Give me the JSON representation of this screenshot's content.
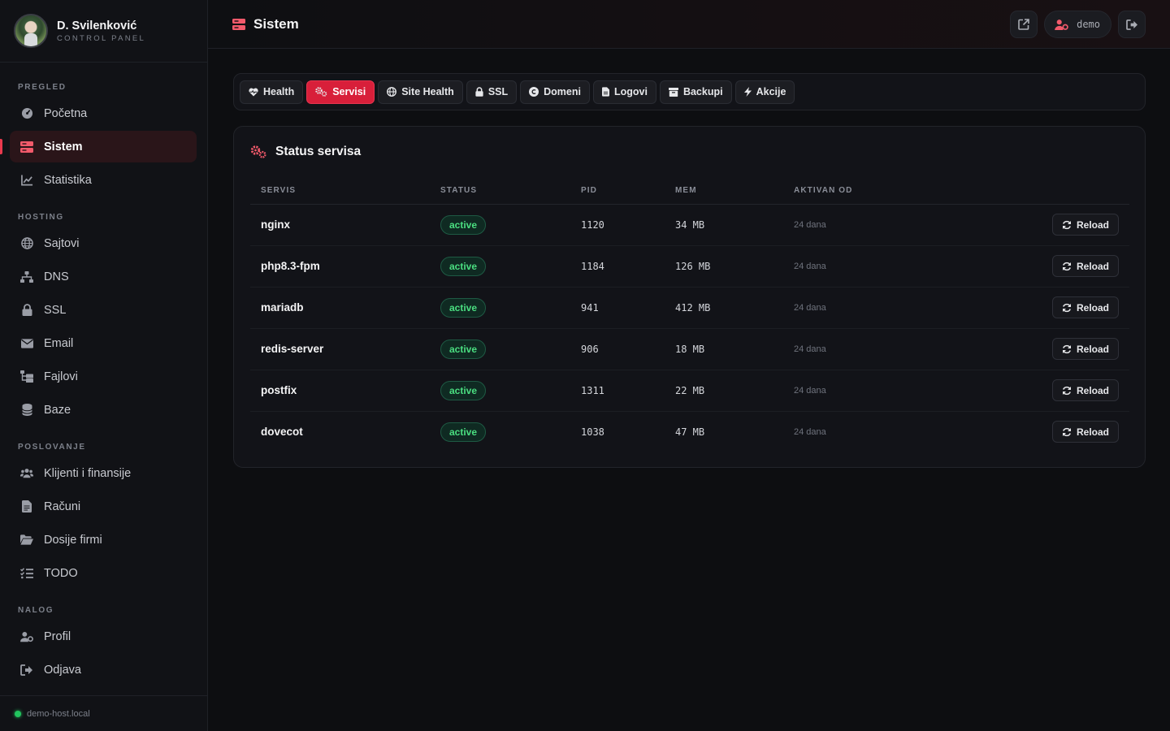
{
  "brand": {
    "name": "D. Svilenković",
    "subtitle": "CONTROL PANEL"
  },
  "sidebar": {
    "sections": [
      {
        "label": "PREGLED",
        "items": [
          {
            "label": "Početna",
            "icon": "gauge-icon"
          },
          {
            "label": "Sistem",
            "icon": "server-icon",
            "active": true
          },
          {
            "label": "Statistika",
            "icon": "chart-line-icon"
          }
        ]
      },
      {
        "label": "HOSTING",
        "items": [
          {
            "label": "Sajtovi",
            "icon": "globe-icon"
          },
          {
            "label": "DNS",
            "icon": "sitemap-icon"
          },
          {
            "label": "SSL",
            "icon": "lock-icon"
          },
          {
            "label": "Email",
            "icon": "envelope-icon"
          },
          {
            "label": "Fajlovi",
            "icon": "folder-tree-icon"
          },
          {
            "label": "Baze",
            "icon": "database-icon"
          }
        ]
      },
      {
        "label": "POSLOVANJE",
        "items": [
          {
            "label": "Klijenti i finansije",
            "icon": "users-icon"
          },
          {
            "label": "Računi",
            "icon": "invoice-icon"
          },
          {
            "label": "Dosije firmi",
            "icon": "folder-open-icon"
          },
          {
            "label": "TODO",
            "icon": "list-check-icon"
          }
        ]
      },
      {
        "label": "NALOG",
        "items": [
          {
            "label": "Profil",
            "icon": "user-gear-icon"
          },
          {
            "label": "Odjava",
            "icon": "sign-out-icon"
          }
        ]
      }
    ],
    "footer": {
      "host": "demo-host.local",
      "status_color": "#22c55e"
    }
  },
  "topbar": {
    "title": "Sistem",
    "username": "demo"
  },
  "tabs": [
    {
      "label": "Health",
      "icon": "heart-pulse-icon"
    },
    {
      "label": "Servisi",
      "icon": "gears-icon",
      "active": true
    },
    {
      "label": "Site Health",
      "icon": "globe-icon"
    },
    {
      "label": "SSL",
      "icon": "lock-icon"
    },
    {
      "label": "Domeni",
      "icon": "copyright-icon"
    },
    {
      "label": "Logovi",
      "icon": "file-icon"
    },
    {
      "label": "Backupi",
      "icon": "archive-icon"
    },
    {
      "label": "Akcije",
      "icon": "bolt-icon"
    }
  ],
  "services_card": {
    "title": "Status servisa",
    "columns": [
      "SERVIS",
      "STATUS",
      "PID",
      "MEM",
      "AKTIVAN OD"
    ],
    "reload_label": "Reload",
    "rows": [
      {
        "name": "nginx",
        "status": "active",
        "pid": "1120",
        "mem": "34 MB",
        "since": "24 dana"
      },
      {
        "name": "php8.3-fpm",
        "status": "active",
        "pid": "1184",
        "mem": "126 MB",
        "since": "24 dana"
      },
      {
        "name": "mariadb",
        "status": "active",
        "pid": "941",
        "mem": "412 MB",
        "since": "24 dana"
      },
      {
        "name": "redis-server",
        "status": "active",
        "pid": "906",
        "mem": "18 MB",
        "since": "24 dana"
      },
      {
        "name": "postfix",
        "status": "active",
        "pid": "1311",
        "mem": "22 MB",
        "since": "24 dana"
      },
      {
        "name": "dovecot",
        "status": "active",
        "pid": "1038",
        "mem": "47 MB",
        "since": "24 dana"
      }
    ]
  },
  "colors": {
    "accent": "#d81f3a",
    "accent_light": "#f25a6b",
    "success": "#4ade80",
    "background": "#0d0e11"
  }
}
